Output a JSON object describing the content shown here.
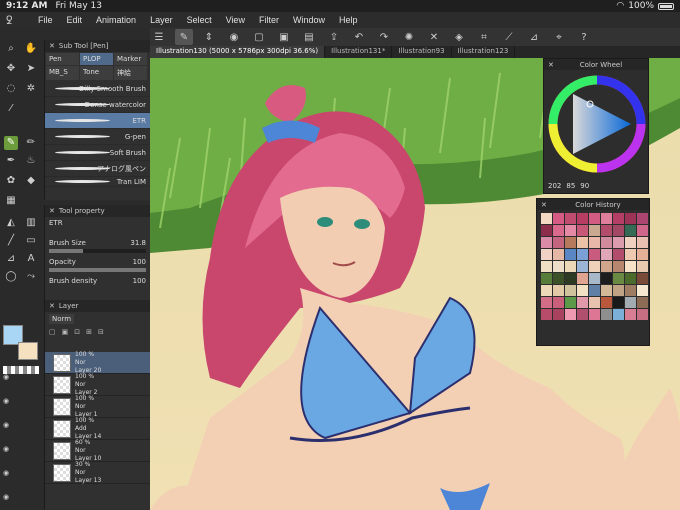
{
  "status": {
    "time": "9:12 AM",
    "date": "Fri May 13",
    "battery": "100%"
  },
  "menu": [
    "File",
    "Edit",
    "Animation",
    "Layer",
    "Select",
    "View",
    "Filter",
    "Window",
    "Help"
  ],
  "doc_tabs": [
    {
      "label": "Illustration130 (5000 x 5786px 300dpi 36.6%)",
      "active": true
    },
    {
      "label": "Illustration131*",
      "active": false
    },
    {
      "label": "Illustration93",
      "active": false
    },
    {
      "label": "Illustration123",
      "active": false
    }
  ],
  "subtool": {
    "title": "Sub Tool [Pen]",
    "tabs": [
      "Pen",
      "PLOP",
      "Marker",
      "MB_S",
      "Tone",
      "神絵"
    ],
    "brushes": [
      "Dilly Smooth Brush",
      "Dense watercolor",
      "ETR",
      "G-pen",
      "Soft Brush",
      "アナログ風ペン",
      "Tran LIM"
    ],
    "selected_brush": "ETR"
  },
  "tool_property": {
    "title": "Tool property",
    "brush_name": "ETR",
    "brush_size_label": "Brush Size",
    "brush_size": "31.8",
    "brush_size_fraction": 0.35,
    "opacity_label": "Opacity",
    "opacity": "100",
    "opacity_fraction": 1.0,
    "density_label": "Brush density",
    "density": "100"
  },
  "layer_panel": {
    "title": "Layer",
    "blend": "Norm",
    "layers": [
      {
        "opacity": "100 %",
        "mode": "Nor",
        "name": "Layer 20",
        "selected": true
      },
      {
        "opacity": "100 %",
        "mode": "Nor",
        "name": "Layer 2",
        "selected": false
      },
      {
        "opacity": "100 %",
        "mode": "Nor",
        "name": "Layer 1",
        "selected": false
      },
      {
        "opacity": "100 %",
        "mode": "Add",
        "name": "Layer 14",
        "selected": false
      },
      {
        "opacity": "60 %",
        "mode": "Nor",
        "name": "Layer 10",
        "selected": false
      },
      {
        "opacity": "30 %",
        "mode": "Nor",
        "name": "Layer 13",
        "selected": false
      }
    ]
  },
  "color_wheel": {
    "title": "Color Wheel",
    "h": "202",
    "s": "85",
    "v": "90"
  },
  "color_history": {
    "title": "Color History",
    "colors": [
      "#f4d9c4",
      "#d55a84",
      "#c04c6f",
      "#b83d62",
      "#d25c82",
      "#e07f9b",
      "#b53e66",
      "#9e3358",
      "#ac4670",
      "#8c2d4b",
      "#d96a8c",
      "#e48aa4",
      "#c85878",
      "#c9aa90",
      "#b34b6b",
      "#a34864",
      "#356b54",
      "#d0678a",
      "#d98ba8",
      "#c4657f",
      "#b87a5c",
      "#ecc3a6",
      "#eab8a9",
      "#cf8a9c",
      "#dc9cae",
      "#f0d0c0",
      "#e9c0b2",
      "#f2d2c4",
      "#e5b8a6",
      "#5a86c4",
      "#7aa0d6",
      "#c95c7e",
      "#dfa7b8",
      "#b24d6b",
      "#edc9b0",
      "#e4b098",
      "#f1dfc3",
      "#eddfc9",
      "#ebd9b8",
      "#9ab5d6",
      "#eed1b8",
      "#cfa68c",
      "#b6866e",
      "#f6e2c8",
      "#e9c9b0",
      "#567d3a",
      "#3b5228",
      "#2c3a24",
      "#e0a590",
      "#a8b8c8",
      "#1e1e1e",
      "#6a8a44",
      "#4a6b2c",
      "#7a4a38",
      "#ecd9b8",
      "#e2caa9",
      "#d0c29c",
      "#f1e0c2",
      "#5f7fa6",
      "#d4b998",
      "#c0a384",
      "#9e7d63",
      "#f6e8d0",
      "#d26d88",
      "#ca5f7c",
      "#5c9a4a",
      "#e09aa9",
      "#e7c2ae",
      "#b9583c",
      "#1a1a1a",
      "#a2aab2",
      "#8e6b55",
      "#b64c6a",
      "#a8425e",
      "#ef9ab0",
      "#b1506e",
      "#dd7694",
      "#8f8e8f",
      "#7bb0d8",
      "#d77e95",
      "#c86e82"
    ]
  }
}
